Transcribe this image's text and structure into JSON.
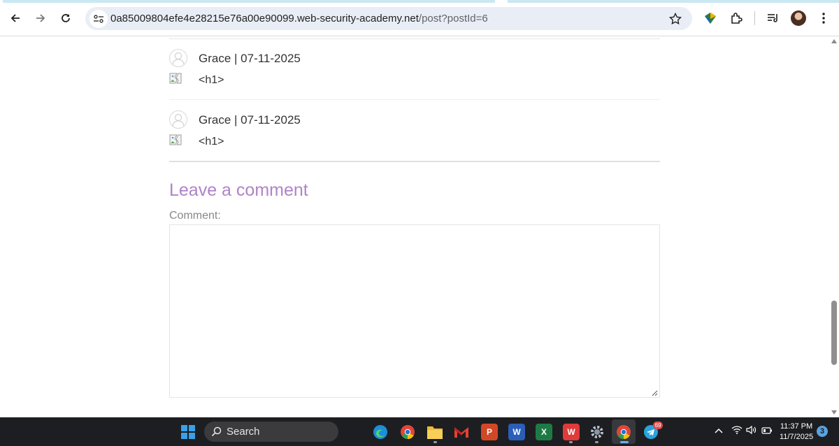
{
  "browser": {
    "url_host": "0a85009804efe4e28215e76a00e90099.web-security-academy.net",
    "url_path": "/post?postId=6"
  },
  "comments": [
    {
      "author": "Grace",
      "separator": " | ",
      "date": "07-11-2025",
      "body": "<h1>"
    },
    {
      "author": "Grace",
      "separator": " | ",
      "date": "07-11-2025",
      "body": "<h1>"
    }
  ],
  "form": {
    "heading": "Leave a comment",
    "comment_label": "Comment:",
    "comment_value": ""
  },
  "taskbar": {
    "search_label": "Search",
    "telegram_badge": "69",
    "time": "11:37 PM",
    "date": "11/7/2025",
    "notification_count": "3"
  },
  "colors": {
    "heading": "#b083c8",
    "taskbar": "#1d1e21",
    "omnibox": "#e9eef6"
  }
}
